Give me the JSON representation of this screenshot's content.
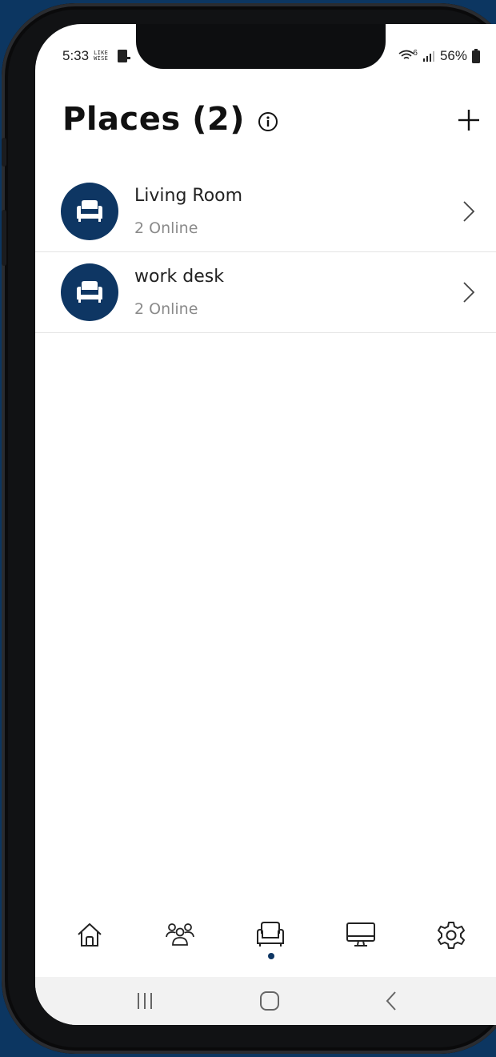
{
  "status_bar": {
    "time": "5:33",
    "carrier_badge": "LIKE WISE",
    "network_gen": "6",
    "battery": "56%"
  },
  "header": {
    "title": "Places (2)",
    "info_icon": "info-circle-icon",
    "add_icon": "plus-icon"
  },
  "places": [
    {
      "name": "Living Room",
      "status": "2 Online",
      "icon": "armchair-icon"
    },
    {
      "name": "work desk",
      "status": "2 Online",
      "icon": "armchair-icon"
    }
  ],
  "bottom_nav": {
    "items": [
      "home-icon",
      "people-icon",
      "armchair-icon",
      "monitor-icon",
      "settings-gear-icon"
    ],
    "active": "armchair-icon"
  },
  "system_nav": [
    "recents-icon",
    "home-button-icon",
    "back-icon"
  ],
  "colors": {
    "accent": "#0e3663",
    "background": "#0c3661",
    "text_primary": "#222222",
    "text_secondary": "#8a8a8a"
  }
}
